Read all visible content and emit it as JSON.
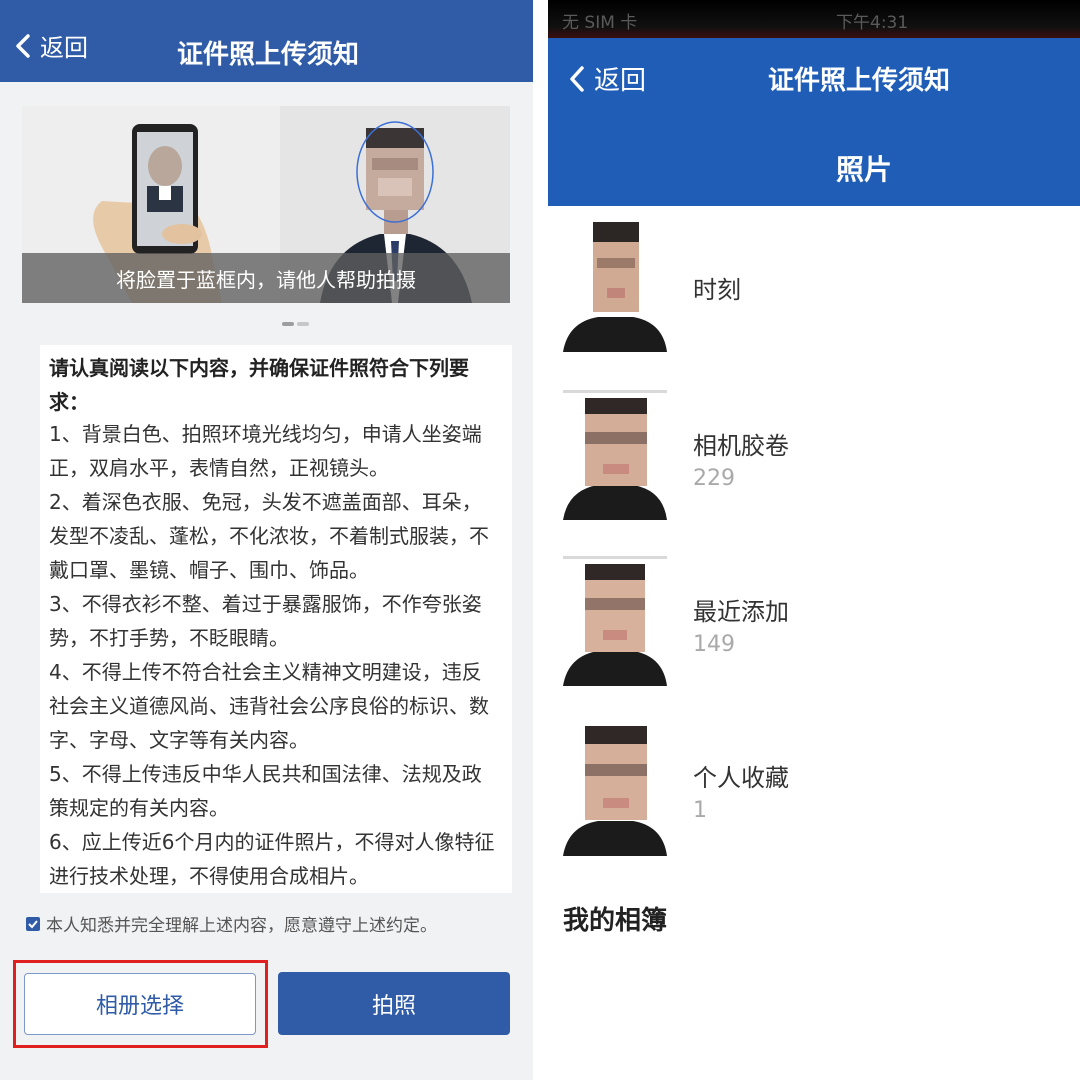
{
  "left_screen": {
    "nav": {
      "back_label": "返回",
      "title": "证件照上传须知"
    },
    "carousel": {
      "caption": "将脸置于蓝框内，请他人帮助拍摄",
      "slide_count": 2,
      "active_index": 0
    },
    "notice": {
      "heading": "请认真阅读以下内容，并确保证件照符合下列要求：",
      "items": [
        "1、背景白色、拍照环境光线均匀，申请人坐姿端正，双肩水平，表情自然，正视镜头。",
        "2、着深色衣服、免冠，头发不遮盖面部、耳朵，发型不凌乱、蓬松，不化浓妆，不着制式服装，不戴口罩、墨镜、帽子、围巾、饰品。",
        "3、不得衣衫不整、着过于暴露服饰，不作夸张姿势，不打手势，不眨眼睛。",
        "4、不得上传不符合社会主义精神文明建设，违反社会主义道德风尚、违背社会公序良俗的标识、数字、字母、文字等有关内容。",
        "5、不得上传违反中华人民共和国法律、法规及政策规定的有关内容。",
        "6、应上传近6个月内的证件照片，不得对人像特征进行技术处理，不得使用合成相片。"
      ]
    },
    "agreement": {
      "text": "本人知悉并完全理解上述内容，愿意遵守上述约定。",
      "checked": true
    },
    "buttons": {
      "album": "相册选择",
      "camera": "拍照"
    }
  },
  "right_screen": {
    "status": {
      "carrier": "无 SIM 卡",
      "time": "下午4:31"
    },
    "nav": {
      "back_label": "返回",
      "title": "证件照上传须知",
      "subtitle": "照片"
    },
    "albums": [
      {
        "name": "时刻",
        "count": ""
      },
      {
        "name": "相机胶卷",
        "count": "229"
      },
      {
        "name": "最近添加",
        "count": "149"
      },
      {
        "name": "个人收藏",
        "count": "1"
      }
    ],
    "section_title": "我的相簿"
  },
  "colors": {
    "left_nav": "#2f5ba7",
    "right_nav": "#1f5db6",
    "primary_button": "#2f5ba7",
    "highlight_border": "#e02020"
  },
  "icons": [
    "chevron-left-icon",
    "check-icon"
  ]
}
